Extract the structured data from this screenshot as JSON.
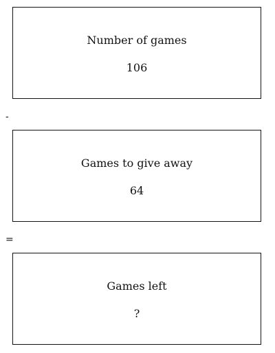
{
  "boxes": [
    {
      "label": "Number of games",
      "value": "106"
    },
    {
      "label": "Games to give away",
      "value": "64"
    },
    {
      "label": "Games left",
      "value": "?"
    }
  ],
  "operators": {
    "minus": "-",
    "equals": "="
  }
}
